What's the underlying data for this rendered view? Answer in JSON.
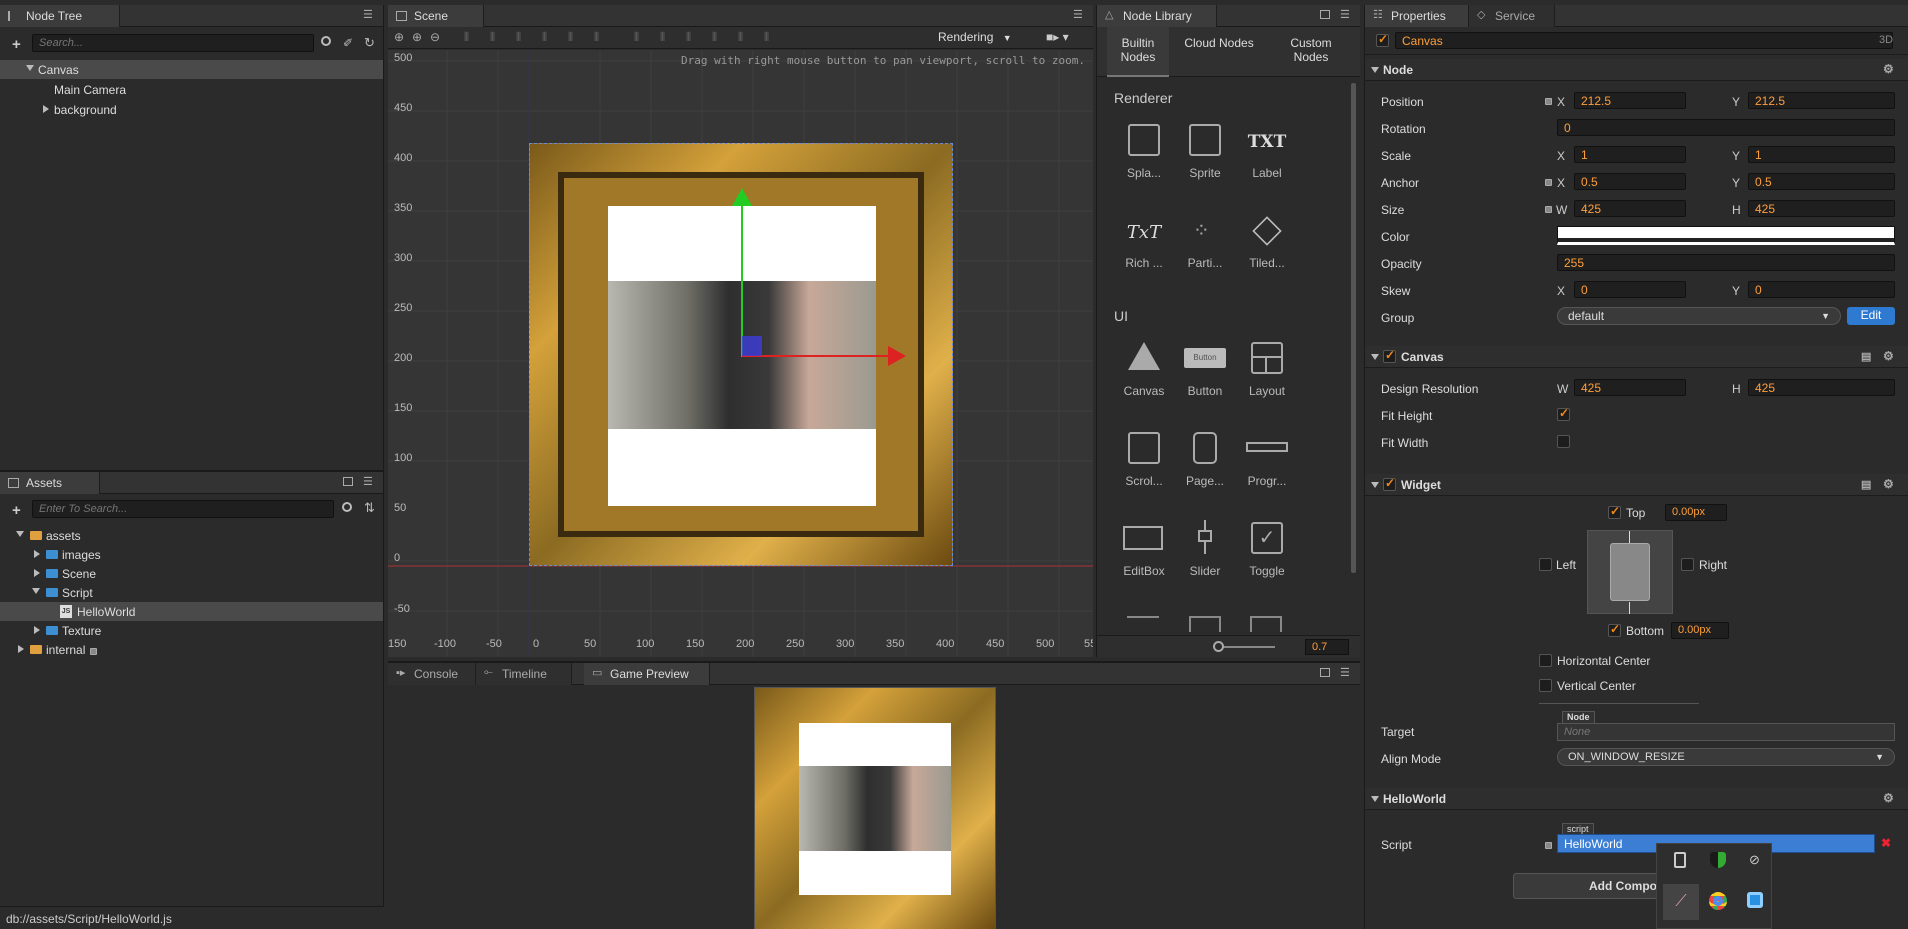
{
  "node_tree": {
    "tab": "Node Tree",
    "search_placeholder": "Search...",
    "items": [
      {
        "label": "Canvas"
      },
      {
        "label": "Main Camera"
      },
      {
        "label": "background"
      }
    ]
  },
  "assets": {
    "tab": "Assets",
    "search_placeholder": "Enter To Search...",
    "items": [
      {
        "label": "assets"
      },
      {
        "label": "images"
      },
      {
        "label": "Scene"
      },
      {
        "label": "Script"
      },
      {
        "label": "HelloWorld"
      },
      {
        "label": "Texture"
      },
      {
        "label": "internal"
      }
    ]
  },
  "status_bar": {
    "path": "db://assets/Script/HelloWorld.js"
  },
  "scene": {
    "tab": "Scene",
    "rendering_label": "Rendering",
    "hint": "Drag with right mouse button to pan viewport, scroll to zoom.",
    "y_ticks": [
      "500",
      "450",
      "400",
      "350",
      "300",
      "250",
      "200",
      "150",
      "100",
      "50",
      "0",
      "-50"
    ],
    "x_ticks": [
      "150",
      "-100",
      "-50",
      "0",
      "50",
      "100",
      "150",
      "200",
      "250",
      "300",
      "350",
      "400",
      "450",
      "500",
      "55"
    ]
  },
  "node_library": {
    "tab": "Node Library",
    "tabs": [
      "Builtin Nodes",
      "Cloud Nodes",
      "Custom Nodes"
    ],
    "renderer_title": "Renderer",
    "renderer_items": [
      "Spla...",
      "Sprite",
      "Label",
      "Rich ...",
      "Parti...",
      "Tiled..."
    ],
    "ui_title": "UI",
    "ui_items": [
      "Canvas",
      "Button",
      "Layout",
      "Scrol...",
      "Page...",
      "Progr...",
      "EditBox",
      "Slider",
      "Toggle"
    ],
    "button_preview_text": "Button",
    "txt_icon": "TXT",
    "richtext_icon": "TxT",
    "zoom_value": "0.7"
  },
  "bottom_tabs": {
    "console": "Console",
    "timeline": "Timeline",
    "game_preview": "Game Preview"
  },
  "properties": {
    "tab": "Properties",
    "service_tab": "Service",
    "three_d": "3D",
    "node_name": "Canvas",
    "node_section": "Node",
    "position": {
      "label": "Position",
      "x": "212.5",
      "y": "212.5"
    },
    "rotation": {
      "label": "Rotation",
      "value": "0"
    },
    "scale": {
      "label": "Scale",
      "x": "1",
      "y": "1"
    },
    "anchor": {
      "label": "Anchor",
      "x": "0.5",
      "y": "0.5"
    },
    "size": {
      "label": "Size",
      "w": "425",
      "h": "425"
    },
    "color": {
      "label": "Color",
      "value": "#ffffff"
    },
    "opacity": {
      "label": "Opacity",
      "value": "255"
    },
    "skew": {
      "label": "Skew",
      "x": "0",
      "y": "0"
    },
    "group": {
      "label": "Group",
      "value": "default",
      "edit": "Edit"
    },
    "axis": {
      "x": "X",
      "y": "Y",
      "w": "W",
      "h": "H"
    },
    "canvas_section": "Canvas",
    "design_resolution": {
      "label": "Design Resolution",
      "w": "425",
      "h": "425"
    },
    "fit_height": "Fit Height",
    "fit_width": "Fit Width",
    "widget_section": "Widget",
    "widget": {
      "top": "Top",
      "top_value": "0.00px",
      "left": "Left",
      "right": "Right",
      "bottom": "Bottom",
      "bottom_value": "0.00px",
      "horizontal_center": "Horizontal Center",
      "vertical_center": "Vertical Center"
    },
    "target": {
      "label": "Target",
      "tag": "Node",
      "value": "None"
    },
    "align_mode": {
      "label": "Align Mode",
      "value": "ON_WINDOW_RESIZE"
    },
    "helloworld_section": "HelloWorld",
    "script": {
      "label": "Script",
      "tag": "script",
      "value": "HelloWorld"
    },
    "add_component": "Add Compo"
  }
}
